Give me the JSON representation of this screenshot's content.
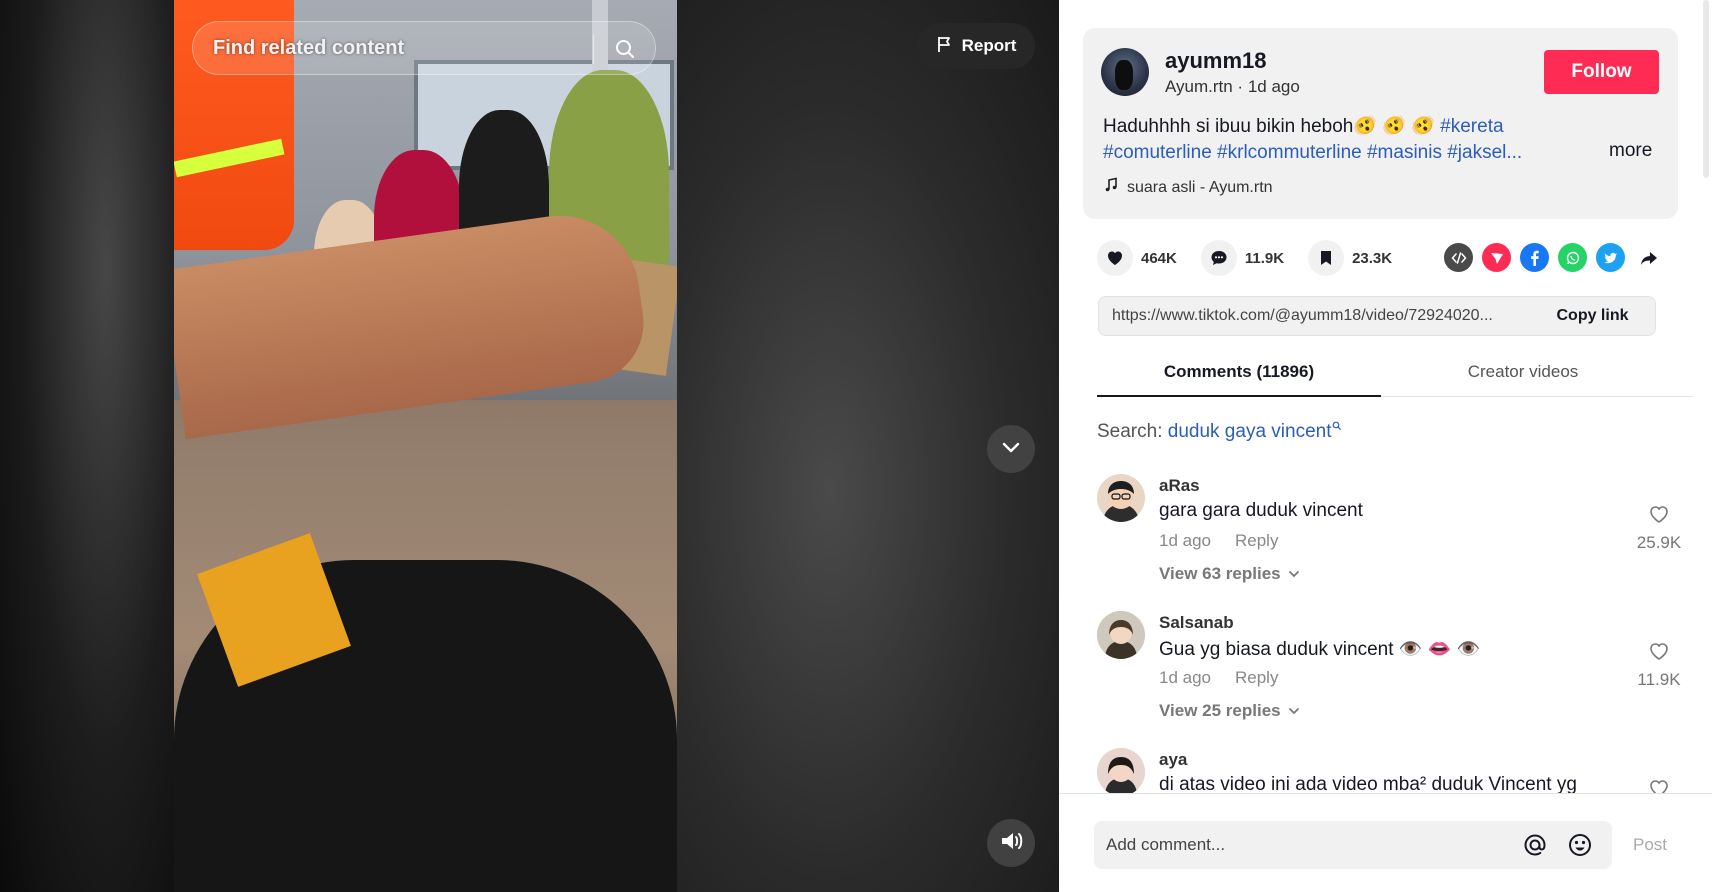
{
  "video": {
    "search_placeholder": "Find related content",
    "report_label": "Report"
  },
  "author": {
    "username": "ayumm18",
    "subtitle": "Ayum.rtn · 1d ago",
    "follow_label": "Follow",
    "desc_text": "Haduhhhh si ibuu bikin heboh🫨 🫨 🫨 ",
    "tag_kereta": "#kereta",
    "desc_line2": "#comuterline #krlcommuterline #masinis #jaksel...",
    "more_label": "more",
    "music": "suara asli - Ayum.rtn"
  },
  "actions": {
    "likes": "464K",
    "comments": "11.9K",
    "saves": "23.3K"
  },
  "share_icons": [
    "embed-icon",
    "send-icon",
    "facebook-icon",
    "whatsapp-icon",
    "twitter-icon",
    "share-arrow-icon"
  ],
  "link": {
    "url": "https://www.tiktok.com/@ayumm18/video/72924020...",
    "copy_label": "Copy link"
  },
  "tabs": {
    "comments": "Comments (11896)",
    "creator": "Creator videos"
  },
  "search": {
    "prefix": "Search:",
    "query": "duduk gaya vincent"
  },
  "comments": [
    {
      "user": "aRas",
      "text": "gara gara duduk vincent",
      "time": "1d ago",
      "reply": "Reply",
      "replies": "View 63 replies",
      "likes": "25.9K"
    },
    {
      "user": "Salsanab",
      "text": "Gua yg biasa duduk vincent 👁️ 👄 👁️",
      "time": "1d ago",
      "reply": "Reply",
      "replies": "View 25 replies",
      "likes": "11.9K"
    },
    {
      "user": "aya",
      "text": "di atas video ini ada video mba² duduk Vincent yg"
    }
  ],
  "composer": {
    "placeholder": "Add comment...",
    "post_label": "Post"
  },
  "colors": {
    "follow": "#fe2c55",
    "hashtag": "#2b5db9"
  }
}
